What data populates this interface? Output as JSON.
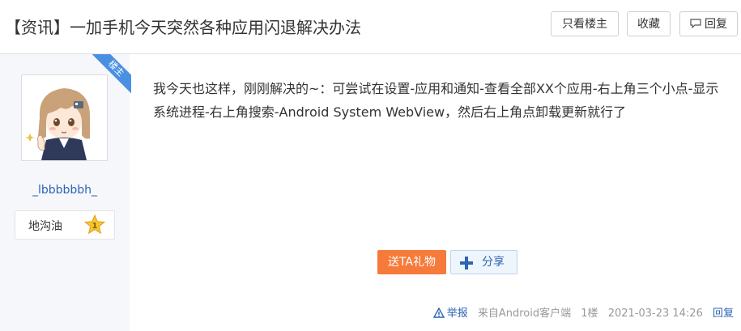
{
  "header": {
    "title": "【资讯】一加手机今天突然各种应用闪退解决办法",
    "only_host_label": "只看楼主",
    "favorite_label": "收藏",
    "reply_label": "回复"
  },
  "badge": {
    "label": "楼主"
  },
  "author": {
    "username": "_lbbbbbbh_",
    "level_name": "地沟油",
    "level_number": "1"
  },
  "post": {
    "content": "我今天也这样，刚刚解决的~：可尝试在设置-应用和通知-查看全部XX个应用-右上角三个小点-显示系统进程-右上角搜索-Android System WebView，然后右上角点卸载更新就行了",
    "gift_label": "送TA礼物",
    "share_label": "分享"
  },
  "footer": {
    "report_label": "举报",
    "source": "来自Android客户端",
    "floor": "1楼",
    "timestamp": "2021-03-23 14:26",
    "reply_label": "回复"
  },
  "colors": {
    "accent_blue": "#2d64b3",
    "gift_orange": "#f67a3a",
    "ribbon_blue": "#4a90e2"
  }
}
